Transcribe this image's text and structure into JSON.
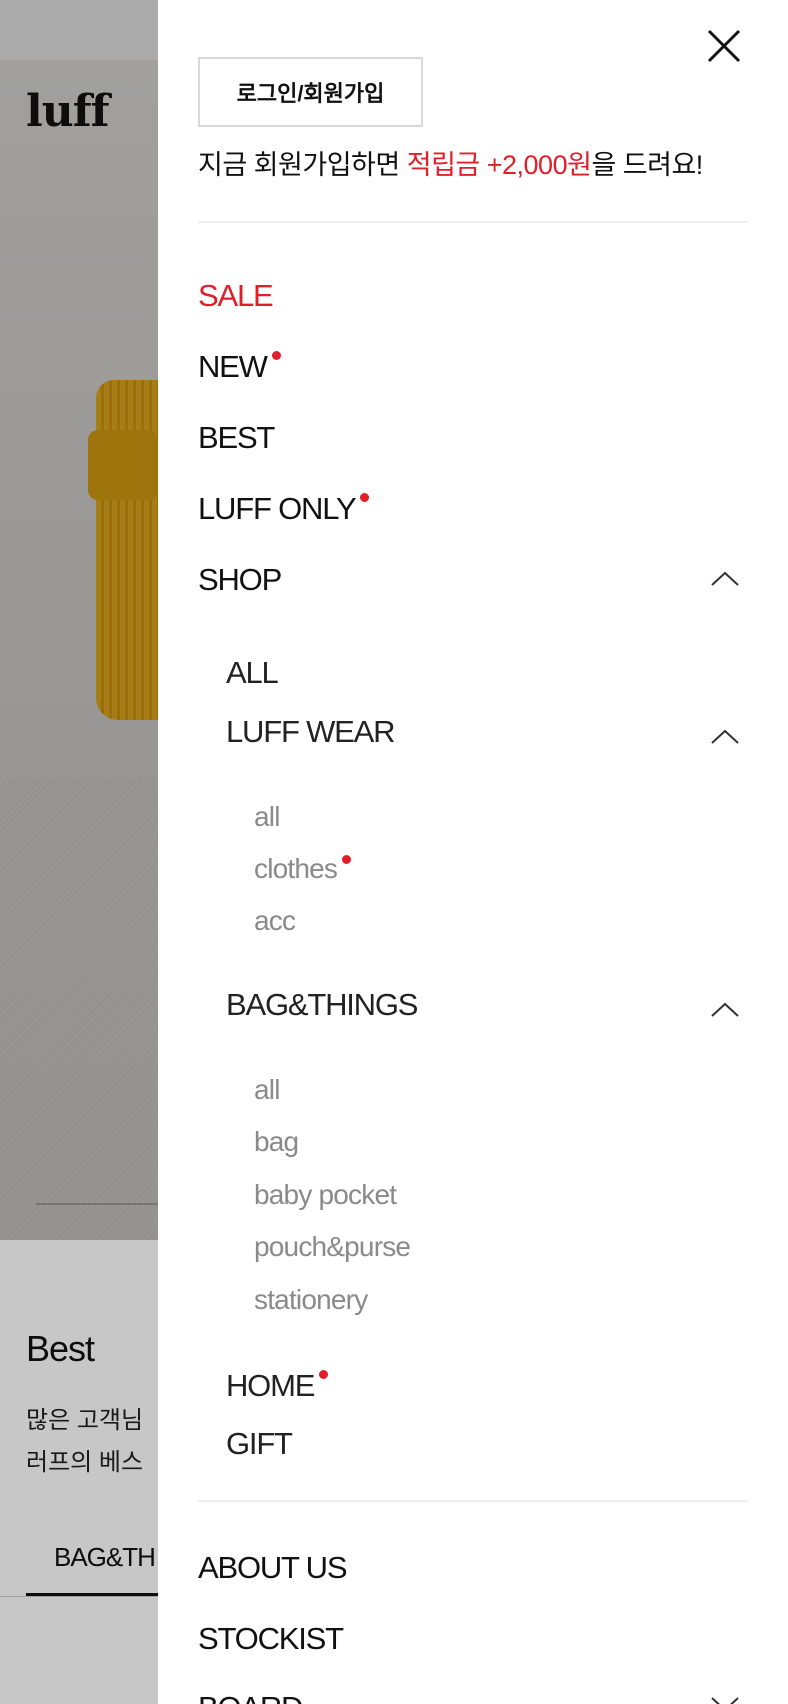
{
  "background": {
    "logo": "luff",
    "section_title": "Best",
    "section_desc": "많은 고객님\n러프의 베스",
    "active_tab": "BAG&TH"
  },
  "drawer": {
    "login_label": "로그인/회원가입",
    "promo": {
      "prefix": "지금 회원가입하면 ",
      "highlight": "적립금 +2,000원",
      "suffix": "을 드려요!"
    },
    "menu": {
      "sale": "SALE",
      "new": "NEW",
      "best": "BEST",
      "luff_only": "LUFF ONLY",
      "shop": "SHOP",
      "shop_children": {
        "all": "ALL",
        "luff_wear": "LUFF WEAR",
        "luff_wear_children": [
          "all",
          "clothes",
          "acc"
        ],
        "bag_things": "BAG&THINGS",
        "bag_things_children": [
          "all",
          "bag",
          "baby pocket",
          "pouch&purse",
          "stationery"
        ],
        "home": "HOME",
        "gift": "GIFT"
      },
      "about_us": "ABOUT US",
      "stockist": "STOCKIST",
      "board": "BOARD"
    },
    "badges": {
      "new": true,
      "luff_only": true,
      "clothes": true,
      "home": true
    },
    "colors": {
      "accent": "#e31e2b",
      "text": "#111111",
      "leaf_text": "#8a8a8a",
      "divider": "#efefef"
    },
    "icons": {
      "close": "close-icon",
      "expand": "chevron-up-icon",
      "collapse": "chevron-down-icon",
      "new_badge": "red-dot-icon"
    }
  }
}
